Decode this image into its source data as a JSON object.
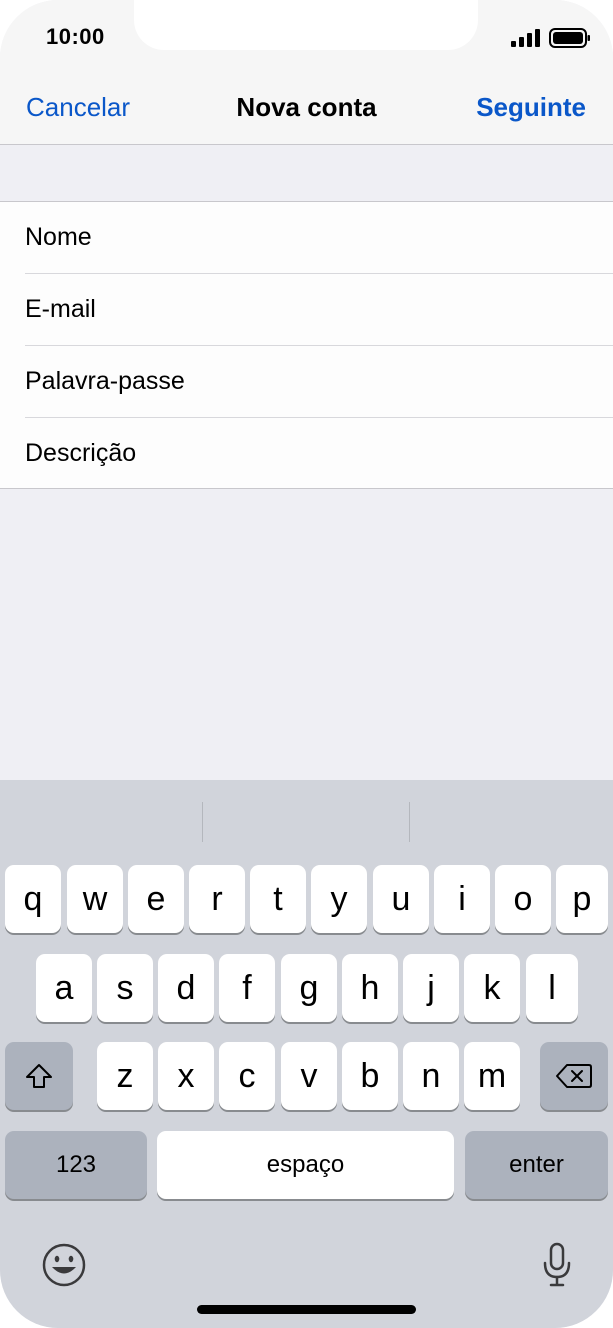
{
  "status_bar": {
    "time": "10:00"
  },
  "nav": {
    "cancel": "Cancelar",
    "title": "Nova conta",
    "next": "Seguinte"
  },
  "form": {
    "fields": [
      {
        "label": "Nome"
      },
      {
        "label": "E-mail"
      },
      {
        "label": "Palavra-passe"
      },
      {
        "label": "Descrição"
      }
    ]
  },
  "keyboard": {
    "row1": [
      "q",
      "w",
      "e",
      "r",
      "t",
      "y",
      "u",
      "i",
      "o",
      "p"
    ],
    "row2": [
      "a",
      "s",
      "d",
      "f",
      "g",
      "h",
      "j",
      "k",
      "l"
    ],
    "row3": [
      "z",
      "x",
      "c",
      "v",
      "b",
      "n",
      "m"
    ],
    "numbers_key": "123",
    "space_key": "espaço",
    "enter_key": "enter",
    "icons": {
      "shift": "shift-icon",
      "backspace": "backspace-icon",
      "emoji": "emoji-icon",
      "mic": "microphone-icon"
    }
  },
  "colors": {
    "accent": "#0a57c9",
    "keyboard_bg": "#d1d4db",
    "special_key": "#acb2bd"
  }
}
